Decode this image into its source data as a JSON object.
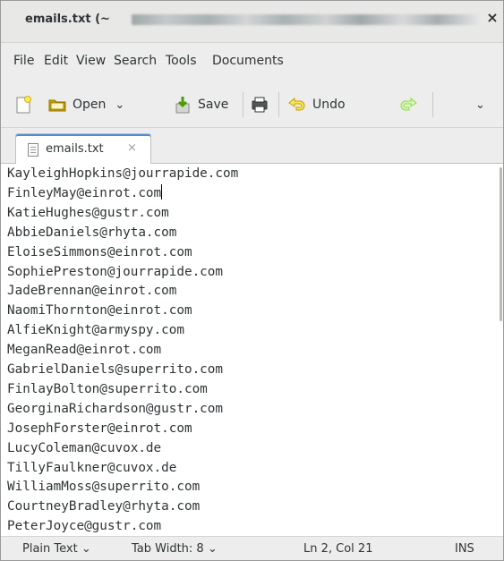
{
  "window": {
    "title": "emails.txt (~",
    "close_glyph": "×"
  },
  "menu": [
    "File",
    "Edit",
    "View",
    "Search",
    "Tools",
    "Documents"
  ],
  "toolbar": {
    "open_label": "Open",
    "save_label": "Save",
    "undo_label": "Undo",
    "dropdown_glyph": "⌄"
  },
  "tab": {
    "label": "emails.txt",
    "close_glyph": "×"
  },
  "editor": {
    "cursor_line": 2,
    "lines": [
      "KayleighHopkins@jourrapide.com",
      "FinleyMay@einrot.com",
      "KatieHughes@gustr.com",
      "AbbieDaniels@rhyta.com",
      "EloiseSimmons@einrot.com",
      "SophiePreston@jourrapide.com",
      "JadeBrennan@einrot.com",
      "NaomiThornton@einrot.com",
      "AlfieKnight@armyspy.com",
      "MeganRead@einrot.com",
      "GabrielDaniels@superrito.com",
      "FinlayBolton@superrito.com",
      "GeorginaRichardson@gustr.com",
      "JosephForster@einrot.com",
      "LucyColeman@cuvox.de",
      "TillyFaulkner@cuvox.de",
      "WilliamMoss@superrito.com",
      "CourtneyBradley@rhyta.com",
      "PeterJoyce@gustr.com"
    ]
  },
  "statusbar": {
    "language": "Plain Text ⌄",
    "tab_width": "Tab Width: 8 ⌄",
    "position": "Ln 2, Col 21",
    "mode": "INS"
  },
  "colors": {
    "accent": "#4a90d9",
    "save_icon": "#4e9a06",
    "undo_icon": "#edd400",
    "redo_icon": "#73d216",
    "folder": "#c4a000"
  }
}
